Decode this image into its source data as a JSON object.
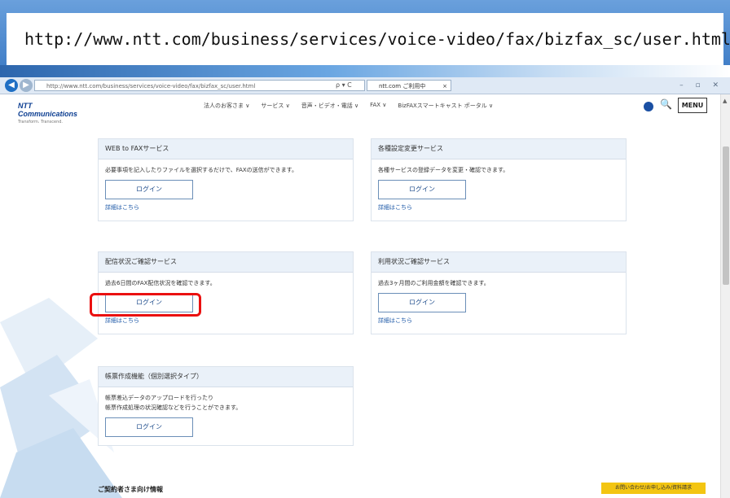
{
  "banner": {
    "url": "http://www.ntt.com/business/services/voice-video/fax/bizfax_sc/user.html"
  },
  "browser": {
    "address_text": "http://www.ntt.com/business/services/voice-video/fax/bizfax_sc/user.html",
    "address_icons": "ρ ▾ C",
    "tab_title": "ntt.com ご利用中",
    "tab_close": "×",
    "window_buttons": "– ▫ ✕",
    "back_glyph": "◀",
    "forward_glyph": "▶"
  },
  "header": {
    "logo_name": "NTT Communications",
    "logo_tagline": "Transform. Transcend.",
    "nav": [
      "法人のお客さま ∨",
      "サービス ∨",
      "音声・ビデオ・電話 ∨",
      "FAX ∨",
      "BizFAXスマートキャスト ポータル ∨"
    ],
    "menu_label": "MENU",
    "search_glyph": "🔍"
  },
  "cards": [
    {
      "title": "WEB to FAXサービス",
      "desc": "必要事項を記入したりファイルを選択するだけで、FAXの送信ができます。",
      "button": "ログイン",
      "link": "詳細はこちら"
    },
    {
      "title": "各種設定変更サービス",
      "desc": "各種サービスの登録データを変更・確認できます。",
      "button": "ログイン",
      "link": "詳細はこちら"
    },
    {
      "title": "配信状況ご確認サービス",
      "desc": "過去6日間のFAX配信状況を確認できます。",
      "button": "ログイン",
      "link": "詳細はこちら"
    },
    {
      "title": "利用状況ご確認サービス",
      "desc": "過去3ヶ月間のご利用金額を確認できます。",
      "button": "ログイン",
      "link": "詳細はこちら"
    },
    {
      "title": "帳票作成機能（個別選択タイプ）",
      "desc": "帳票差込データのアップロードを行ったり",
      "desc2": "帳票作成処理の状況確認などを行うことができます。",
      "button": "ログイン"
    }
  ],
  "footer": {
    "contract_info": "ご契約者さま向け情報",
    "inquiry_button": "お問い合わせ/お申し込み/資料請求"
  },
  "colors": {
    "highlight": "#ea1010",
    "banner": "#3a79c4",
    "card_header": "#eaf1f9",
    "link": "#1a56a6"
  }
}
